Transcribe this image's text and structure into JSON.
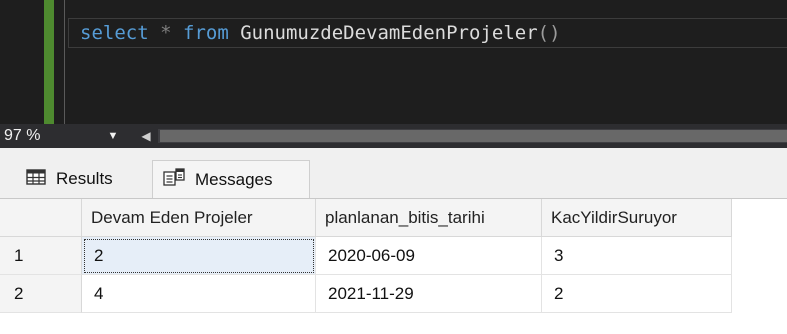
{
  "editor": {
    "query_tokens": {
      "kw_select": "select",
      "op_star": "*",
      "kw_from": "from",
      "identifier": "GunumuzdeDevamEdenProjeler",
      "parens": "()"
    }
  },
  "zoom": {
    "value": "97 %",
    "dropdown_glyph": "▼",
    "scroll_left_glyph": "◀"
  },
  "tabs": {
    "results_label": "Results",
    "messages_label": "Messages"
  },
  "grid": {
    "columns": [
      "Devam Eden Projeler",
      "planlanan_bitis_tarihi",
      "KacYildirSuruyor"
    ],
    "rows": [
      {
        "num": "1",
        "cells": [
          "2",
          "2020-06-09",
          "3"
        ]
      },
      {
        "num": "2",
        "cells": [
          "4",
          "2021-11-29",
          "2"
        ]
      }
    ]
  },
  "colors": {
    "editor_bg": "#1e1e1e",
    "keyword": "#569cd6",
    "change_bar": "#4e8a2f",
    "selection_bg": "#e6eef8"
  }
}
